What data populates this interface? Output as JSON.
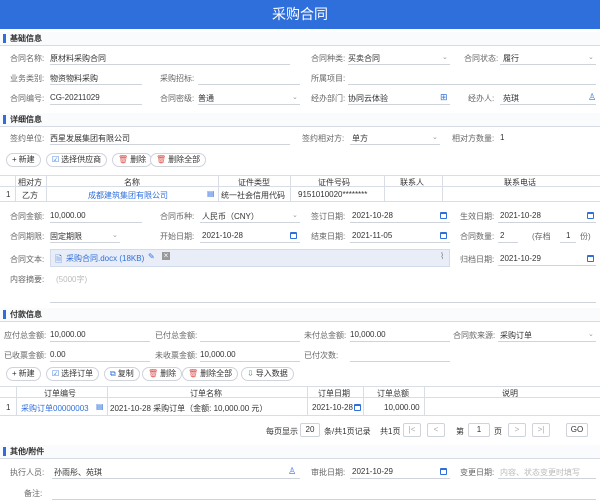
{
  "title": "采购合同",
  "sections": {
    "basic": "基础信息",
    "detail": "详细信息",
    "payment": "付款信息",
    "attach": "其他/附件"
  },
  "basic": {
    "contract_name_label": "合同名称:",
    "contract_name": "原材料采购合同",
    "contract_type_label": "合同种类:",
    "contract_type": "买卖合同",
    "contract_status_label": "合同状态:",
    "contract_status": "履行",
    "biz_type_label": "业务类别:",
    "biz_type": "物资物料采购",
    "bid_label": "采购招标:",
    "bid": "",
    "project_label": "所属项目:",
    "project": "",
    "contract_no_label": "合同编号:",
    "contract_no": "CG-20211029",
    "secret_label": "合同密级:",
    "secret": "普通",
    "dept_label": "经办部门:",
    "dept": "协同云体验",
    "handler_label": "经办人:",
    "handler": "苑琪"
  },
  "detail": {
    "sign_unit_label": "签约单位:",
    "sign_unit": "西星发展集团有限公司",
    "party_label": "签约相对方:",
    "party": "单方",
    "party_count_label": "相对方数量:",
    "party_count": "1",
    "buttons": [
      "新建",
      "选择供应商",
      "删除",
      "删除全部"
    ],
    "table_headers": [
      "相对方",
      "名称",
      "证件类型",
      "证件号码",
      "联系人",
      "联系电话"
    ],
    "row": {
      "no": "1",
      "party": "乙方",
      "name": "成都建筑集团有限公司",
      "id_type": "统一社会信用代码",
      "id_no": "9151010020********",
      "contact": "",
      "phone": ""
    },
    "amount_label": "合同金额:",
    "amount": "10,000.00",
    "currency_label": "合同币种:",
    "currency": "人民币（CNY）",
    "sign_date_label": "签订日期:",
    "sign_date": "2021-10-28",
    "effect_date_label": "生效日期:",
    "effect_date": "2021-10-28",
    "term_label": "合同期限:",
    "term": "固定期限",
    "start_label": "开始日期:",
    "start": "2021-10-28",
    "end_label": "结束日期:",
    "end": "2021-11-05",
    "copies_label": "合同数量:",
    "copies": "2",
    "keep_label": "(存档",
    "keep": "1",
    "keep_unit": "份)",
    "text_label": "合同文本:",
    "file": "采购合同.docx (18KB)",
    "archive_label": "归档日期:",
    "archive": "2021-10-29",
    "summary_label": "内容摘要:",
    "summary_placeholder": "(5000字)"
  },
  "payment": {
    "due_label": "应付总金额:",
    "due": "10,000.00",
    "paid_label": "已付总金额:",
    "paid": "",
    "unpaid_label": "未付总金额:",
    "unpaid": "10,000.00",
    "source_label": "合同款来源:",
    "source": "采购订单",
    "invoiced_label": "已收票金额:",
    "invoiced": "0.00",
    "uninvoiced_label": "未收票金额:",
    "uninvoiced": "10,000.00",
    "times_label": "已付次数:",
    "times": "",
    "buttons": [
      "新建",
      "选择订单",
      "复制",
      "删除",
      "删除全部",
      "导入数据"
    ],
    "headers": [
      "订单编号",
      "订单名称",
      "订单日期",
      "订单总额",
      "说明"
    ],
    "row": {
      "no": "1",
      "order_no": "采购订单00000003",
      "order_name": "2021-10-28 采购订单（金额: 10,000.00 元）",
      "order_date": "2021-10-28",
      "order_total": "10,000.00",
      "note": ""
    },
    "pager": {
      "per_page_label": "每页显示",
      "per_page": "20",
      "summary": "条/共1页记录",
      "total": "共1页",
      "page_label": "第",
      "page": "1",
      "page_unit": "页",
      "go": "GO"
    }
  },
  "attach": {
    "executor_label": "执行人员:",
    "executor": "孙雨彤、苑琪",
    "audit_date_label": "审批日期:",
    "audit_date": "2021-10-29",
    "change_date_label": "变更日期:",
    "change_date_placeholder": "内容、状态变更时填写",
    "remark_label": "备注:",
    "remark": ""
  }
}
